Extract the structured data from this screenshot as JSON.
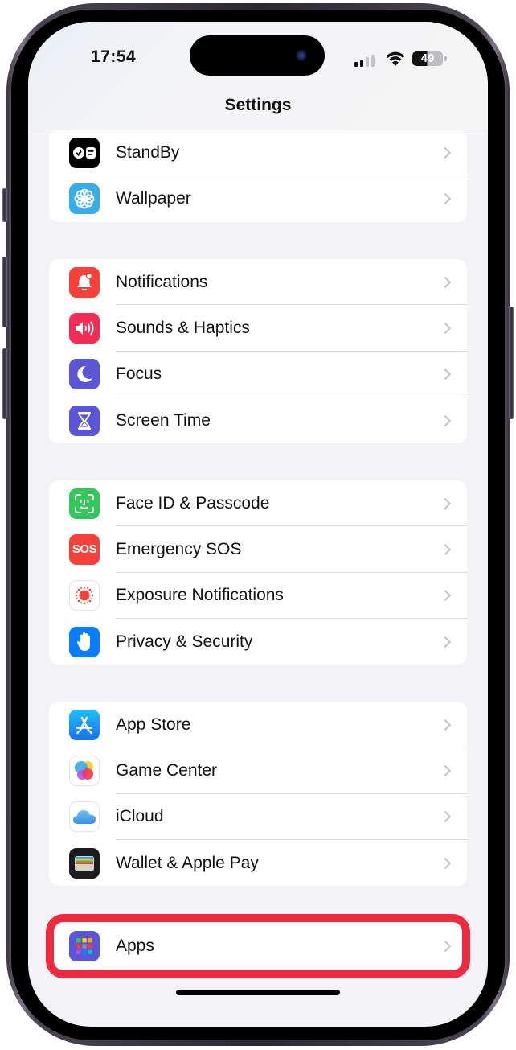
{
  "status_bar": {
    "time": "17:54",
    "battery_level": "49",
    "signal_bars_active": 2,
    "signal_bars_total": 4
  },
  "header": {
    "title": "Settings"
  },
  "groups": [
    {
      "items": [
        {
          "label": "StandBy",
          "icon": "standby-icon",
          "color": "#000000"
        },
        {
          "label": "Wallpaper",
          "icon": "wallpaper-flower-icon",
          "color": "#36aee8"
        }
      ]
    },
    {
      "items": [
        {
          "label": "Notifications",
          "icon": "bell-badge-icon",
          "color": "#f5413a"
        },
        {
          "label": "Sounds & Haptics",
          "icon": "speaker-icon",
          "color": "#f32c55"
        },
        {
          "label": "Focus",
          "icon": "moon-icon",
          "color": "#5a56d6"
        },
        {
          "label": "Screen Time",
          "icon": "hourglass-icon",
          "color": "#5a56d6"
        }
      ]
    },
    {
      "items": [
        {
          "label": "Face ID & Passcode",
          "icon": "face-id-icon",
          "color": "#34c759"
        },
        {
          "label": "Emergency SOS",
          "icon": "sos-icon",
          "color": "#f5413a",
          "icon_text": "SOS"
        },
        {
          "label": "Exposure Notifications",
          "icon": "exposure-sun-icon",
          "color": "#ffffff"
        },
        {
          "label": "Privacy & Security",
          "icon": "hand-icon",
          "color": "#0a7cff"
        }
      ]
    },
    {
      "items": [
        {
          "label": "App Store",
          "icon": "app-store-icon",
          "color": "#1a8cf8"
        },
        {
          "label": "Game Center",
          "icon": "game-center-icon",
          "color": "#ffffff"
        },
        {
          "label": "iCloud",
          "icon": "cloud-icon",
          "color": "#ffffff"
        },
        {
          "label": "Wallet & Apple Pay",
          "icon": "wallet-icon",
          "color": "#1c1c1e"
        }
      ]
    },
    {
      "items": [
        {
          "label": "Apps",
          "icon": "apps-grid-icon",
          "color": "#5a56d6"
        }
      ]
    }
  ],
  "annotation": {
    "highlight_color": "#ee2a3e",
    "highlighted_item": "Apps"
  }
}
